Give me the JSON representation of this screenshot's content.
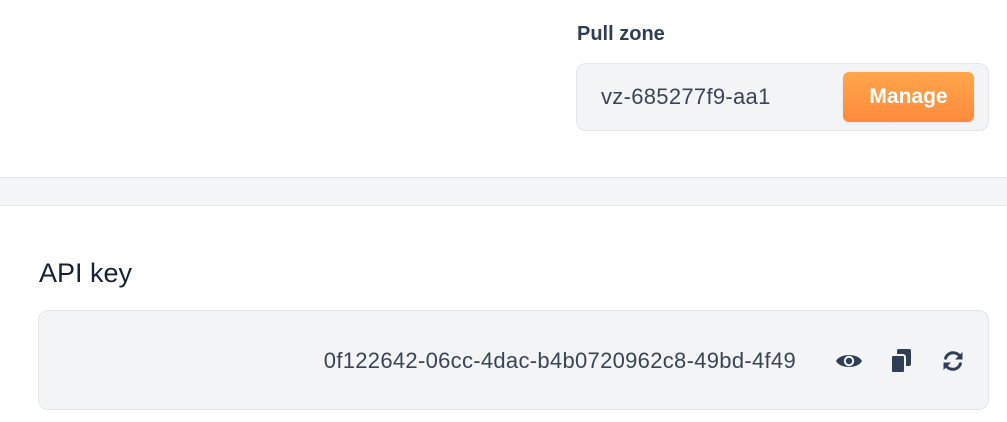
{
  "pull_zone": {
    "label": "Pull zone",
    "value": "vz-685277f9-aa1",
    "manage_label": "Manage"
  },
  "api_key": {
    "title": "API key",
    "value": "0f122642-06cc-4dac-b4b0720962c8-49bd-4f49",
    "icons": [
      "eye-icon",
      "copy-icon",
      "refresh-icon"
    ]
  },
  "colors": {
    "accent": "#ff9642",
    "text": "#1f2d45",
    "field_bg": "#f3f4f6",
    "icon": "#2f3e55"
  }
}
